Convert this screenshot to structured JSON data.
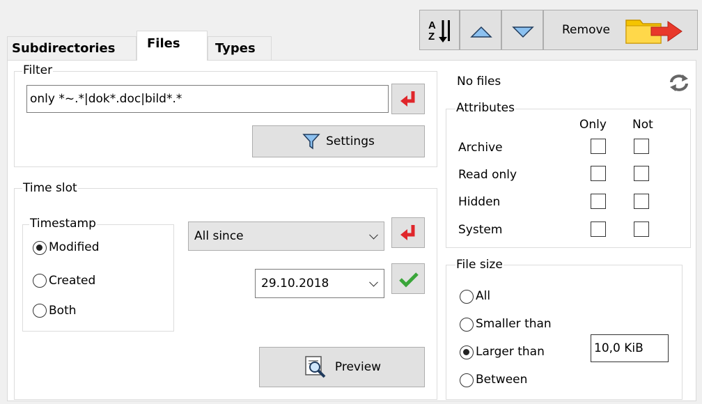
{
  "tabs": [
    {
      "label": "Subdirectories"
    },
    {
      "label": "Files"
    },
    {
      "label": "Types"
    }
  ],
  "toolbar": {
    "sort_icon": "sort-az-icon",
    "up_icon": "triangle-up-icon",
    "down_icon": "triangle-down-icon",
    "remove_label": "Remove",
    "remove_icon": "folder-arrow-icon"
  },
  "filter": {
    "group_label": "Filter",
    "value": "only *~.*|dok*.doc|bild*.*",
    "settings_label": "Settings"
  },
  "time_slot": {
    "group_label": "Time slot",
    "timestamp": {
      "group_label": "Timestamp",
      "options": [
        {
          "label": "Modified",
          "selected": true
        },
        {
          "label": "Created",
          "selected": false
        },
        {
          "label": "Both",
          "selected": false
        }
      ]
    },
    "mode_value": "All since",
    "date_value": "29.10.2018",
    "preview_label": "Preview"
  },
  "info": {
    "status": "No files",
    "refresh_icon": "refresh-icon"
  },
  "attributes": {
    "group_label": "Attributes",
    "col_only": "Only",
    "col_not": "Not",
    "rows": [
      {
        "label": "Archive",
        "only": false,
        "not": false
      },
      {
        "label": "Read only",
        "only": false,
        "not": false
      },
      {
        "label": "Hidden",
        "only": false,
        "not": false
      },
      {
        "label": "System",
        "only": false,
        "not": false
      }
    ]
  },
  "file_size": {
    "group_label": "File size",
    "options": [
      {
        "label": "All",
        "selected": false
      },
      {
        "label": "Smaller than",
        "selected": false
      },
      {
        "label": "Larger than",
        "selected": true
      },
      {
        "label": "Between",
        "selected": false
      }
    ],
    "size_value": "10,0 KiB"
  },
  "colors": {
    "enter_arrow": "#e0262b",
    "check": "#3aa63a",
    "folder": "#f5c400",
    "arrow_red": "#e8392b"
  }
}
